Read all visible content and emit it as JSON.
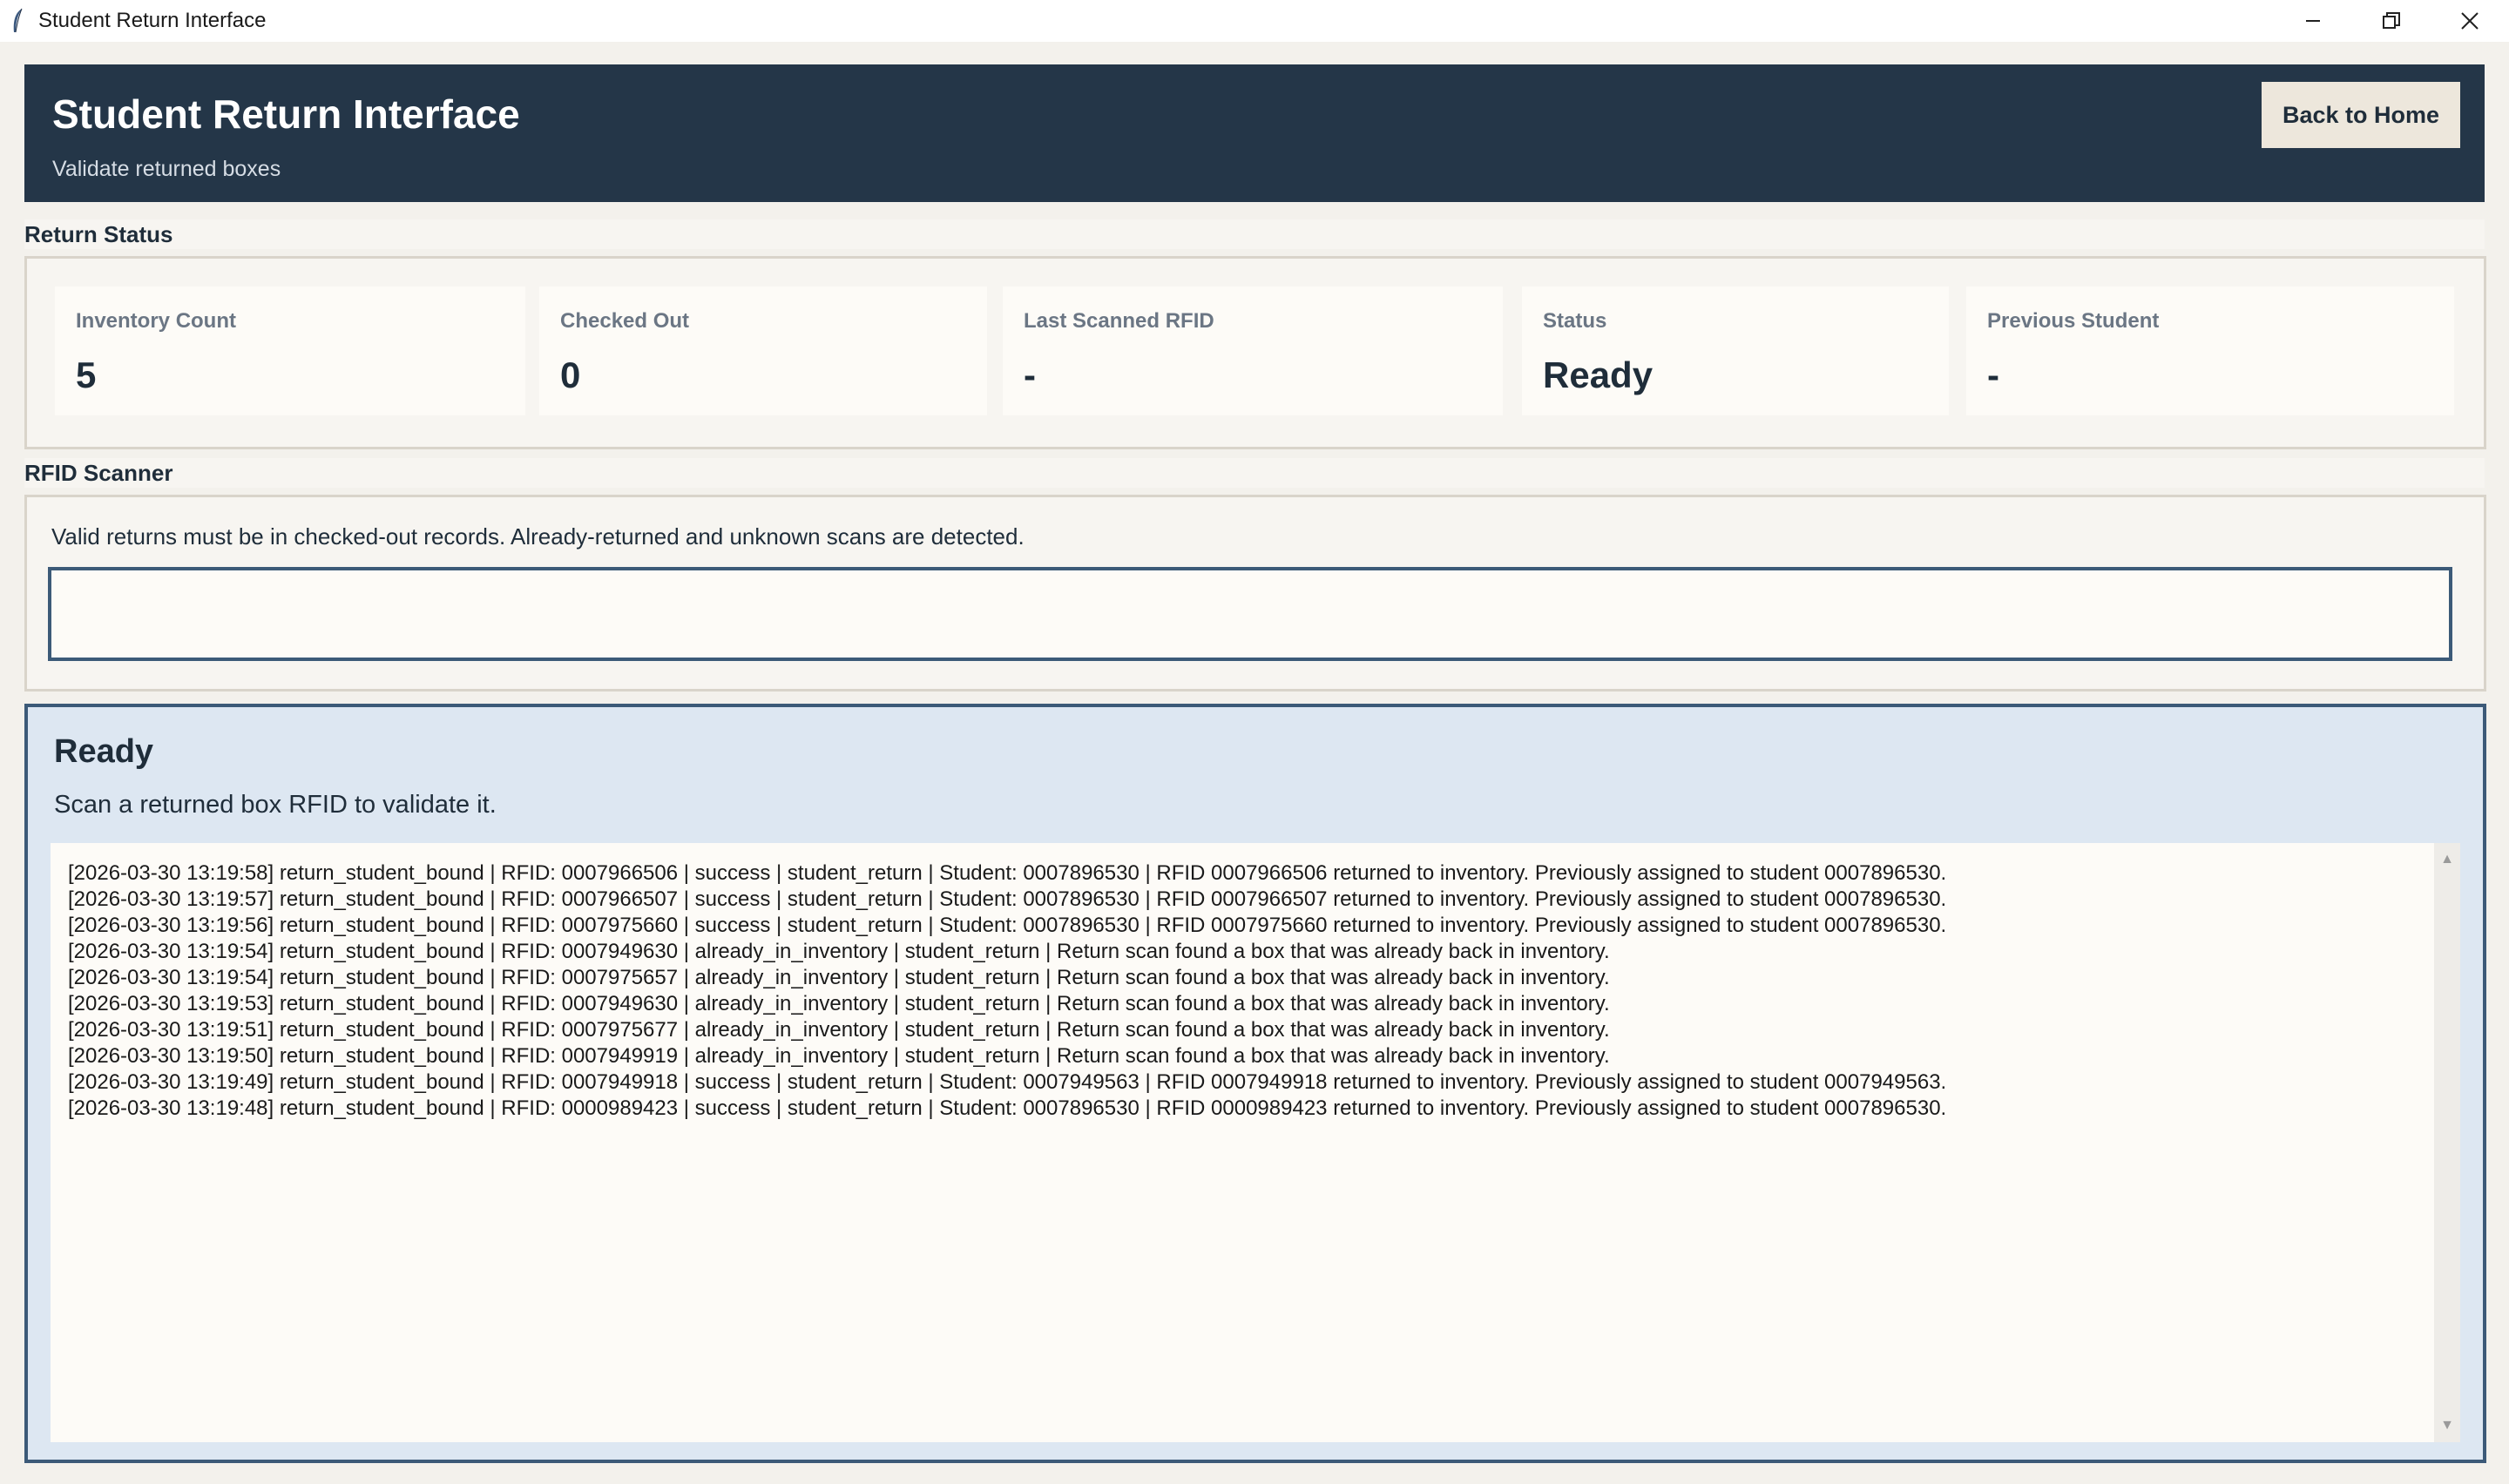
{
  "window": {
    "title": "Student Return Interface",
    "controls": {
      "minimize": "minimize-icon",
      "maximize": "maximize-icon",
      "close": "close-icon"
    }
  },
  "header": {
    "title": "Student Return Interface",
    "subtitle": "Validate returned boxes",
    "back_label": "Back to Home",
    "bg_color": "#243648"
  },
  "return_status": {
    "section_label": "Return Status",
    "cards": [
      {
        "label": "Inventory Count",
        "value": "5"
      },
      {
        "label": "Checked Out",
        "value": "0"
      },
      {
        "label": "Last Scanned RFID",
        "value": "-"
      },
      {
        "label": "Status",
        "value": "Ready"
      },
      {
        "label": "Previous Student",
        "value": "-"
      }
    ]
  },
  "scanner": {
    "section_label": "RFID Scanner",
    "hint": "Valid returns must be in checked-out records. Already-returned and unknown scans are detected.",
    "input_value": ""
  },
  "result": {
    "title": "Ready",
    "message": "Scan a returned box RFID to validate it.",
    "log": [
      "[2026-03-30 13:19:58] return_student_bound | RFID: 0007966506 | success | student_return | Student: 0007896530 | RFID 0007966506 returned to inventory. Previously assigned to student 0007896530.",
      "[2026-03-30 13:19:57] return_student_bound | RFID: 0007966507 | success | student_return | Student: 0007896530 | RFID 0007966507 returned to inventory. Previously assigned to student 0007896530.",
      "[2026-03-30 13:19:56] return_student_bound | RFID: 0007975660 | success | student_return | Student: 0007896530 | RFID 0007975660 returned to inventory. Previously assigned to student 0007896530.",
      "[2026-03-30 13:19:54] return_student_bound | RFID: 0007949630 | already_in_inventory | student_return | Return scan found a box that was already back in inventory.",
      "[2026-03-30 13:19:54] return_student_bound | RFID: 0007975657 | already_in_inventory | student_return | Return scan found a box that was already back in inventory.",
      "[2026-03-30 13:19:53] return_student_bound | RFID: 0007949630 | already_in_inventory | student_return | Return scan found a box that was already back in inventory.",
      "[2026-03-30 13:19:51] return_student_bound | RFID: 0007975677 | already_in_inventory | student_return | Return scan found a box that was already back in inventory.",
      "[2026-03-30 13:19:50] return_student_bound | RFID: 0007949919 | already_in_inventory | student_return | Return scan found a box that was already back in inventory.",
      "[2026-03-30 13:19:49] return_student_bound | RFID: 0007949918 | success | student_return | Student: 0007949563 | RFID 0007949918 returned to inventory. Previously assigned to student 0007949563.",
      "[2026-03-30 13:19:48] return_student_bound | RFID: 0000989423 | success | student_return | Student: 0007896530 | RFID 0000989423 returned to inventory. Previously assigned to student 0007896530."
    ]
  }
}
